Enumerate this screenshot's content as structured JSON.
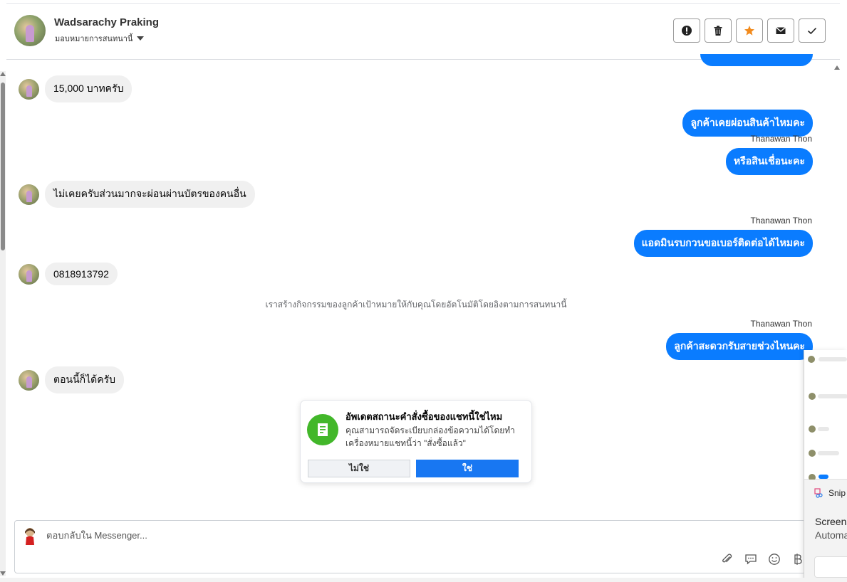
{
  "header": {
    "name": "Wadsarachy Praking",
    "assign_label": "มอบหมายการสนทนานี้",
    "actions": [
      {
        "icon": "alert-icon",
        "label": "Mark as spam"
      },
      {
        "icon": "trash-icon",
        "label": "Delete"
      },
      {
        "icon": "star-icon",
        "label": "Follow up"
      },
      {
        "icon": "envelope-icon",
        "label": "Mark as unread"
      },
      {
        "icon": "check-icon",
        "label": "Mark as done"
      }
    ],
    "star_color": "#f28a1c"
  },
  "messages": {
    "in_1": "15,000 บาทครับ",
    "out_1": "ลูกค้าเคยผ่อนสินค้าไหมคะ",
    "sender_1": "Thanawan Thon",
    "out_2": "หรือสินเชื่อนะคะ",
    "in_2": "ไม่เคยครับส่วนมากจะผ่อนผ่านบัตรของคนอื่น",
    "sender_2": "Thanawan Thon",
    "out_3": "แอดมินรบกวนขอเบอร์ติดต่อได้ไหมคะ",
    "in_3": "0818913792",
    "system_note": "เราสร้างกิจกรรมของลูกค้าเป้าหมายให้กับคุณโดยอัตโนมัติโดยอิงตามการสนทนานี้",
    "sender_3": "Thanawan Thon",
    "out_4": "ลูกค้าสะดวกรับสายช่วงไหนคะ",
    "in_4": "ตอนนี้ก็ได้ครับ"
  },
  "order_card": {
    "title": "อัพเดตสถานะคำสั่งซื้อของแชทนี้ใช่ไหม",
    "body": "คุณสามารถจัดระเบียบกล่องข้อความได้โดยทำเครื่องหมายแชทนี้ว่า \"สั่งซื้อแล้ว\"",
    "no_label": "ไม่ใช่",
    "yes_label": "ใช่",
    "icon": "receipt-icon",
    "accent": "#42b72a"
  },
  "composer": {
    "placeholder": "ตอบกลับใน Messenger...",
    "tools": [
      "paperclip-icon",
      "saved-reply-icon",
      "emoji-icon",
      "baht-icon"
    ]
  },
  "snip_popup": {
    "app_name": "Snip",
    "line1": "Screens",
    "line2": "Automa"
  },
  "colors": {
    "outgoing_bubble": "#0a7cff",
    "incoming_bubble": "#f0f0f0",
    "primary_button": "#1877f2"
  }
}
